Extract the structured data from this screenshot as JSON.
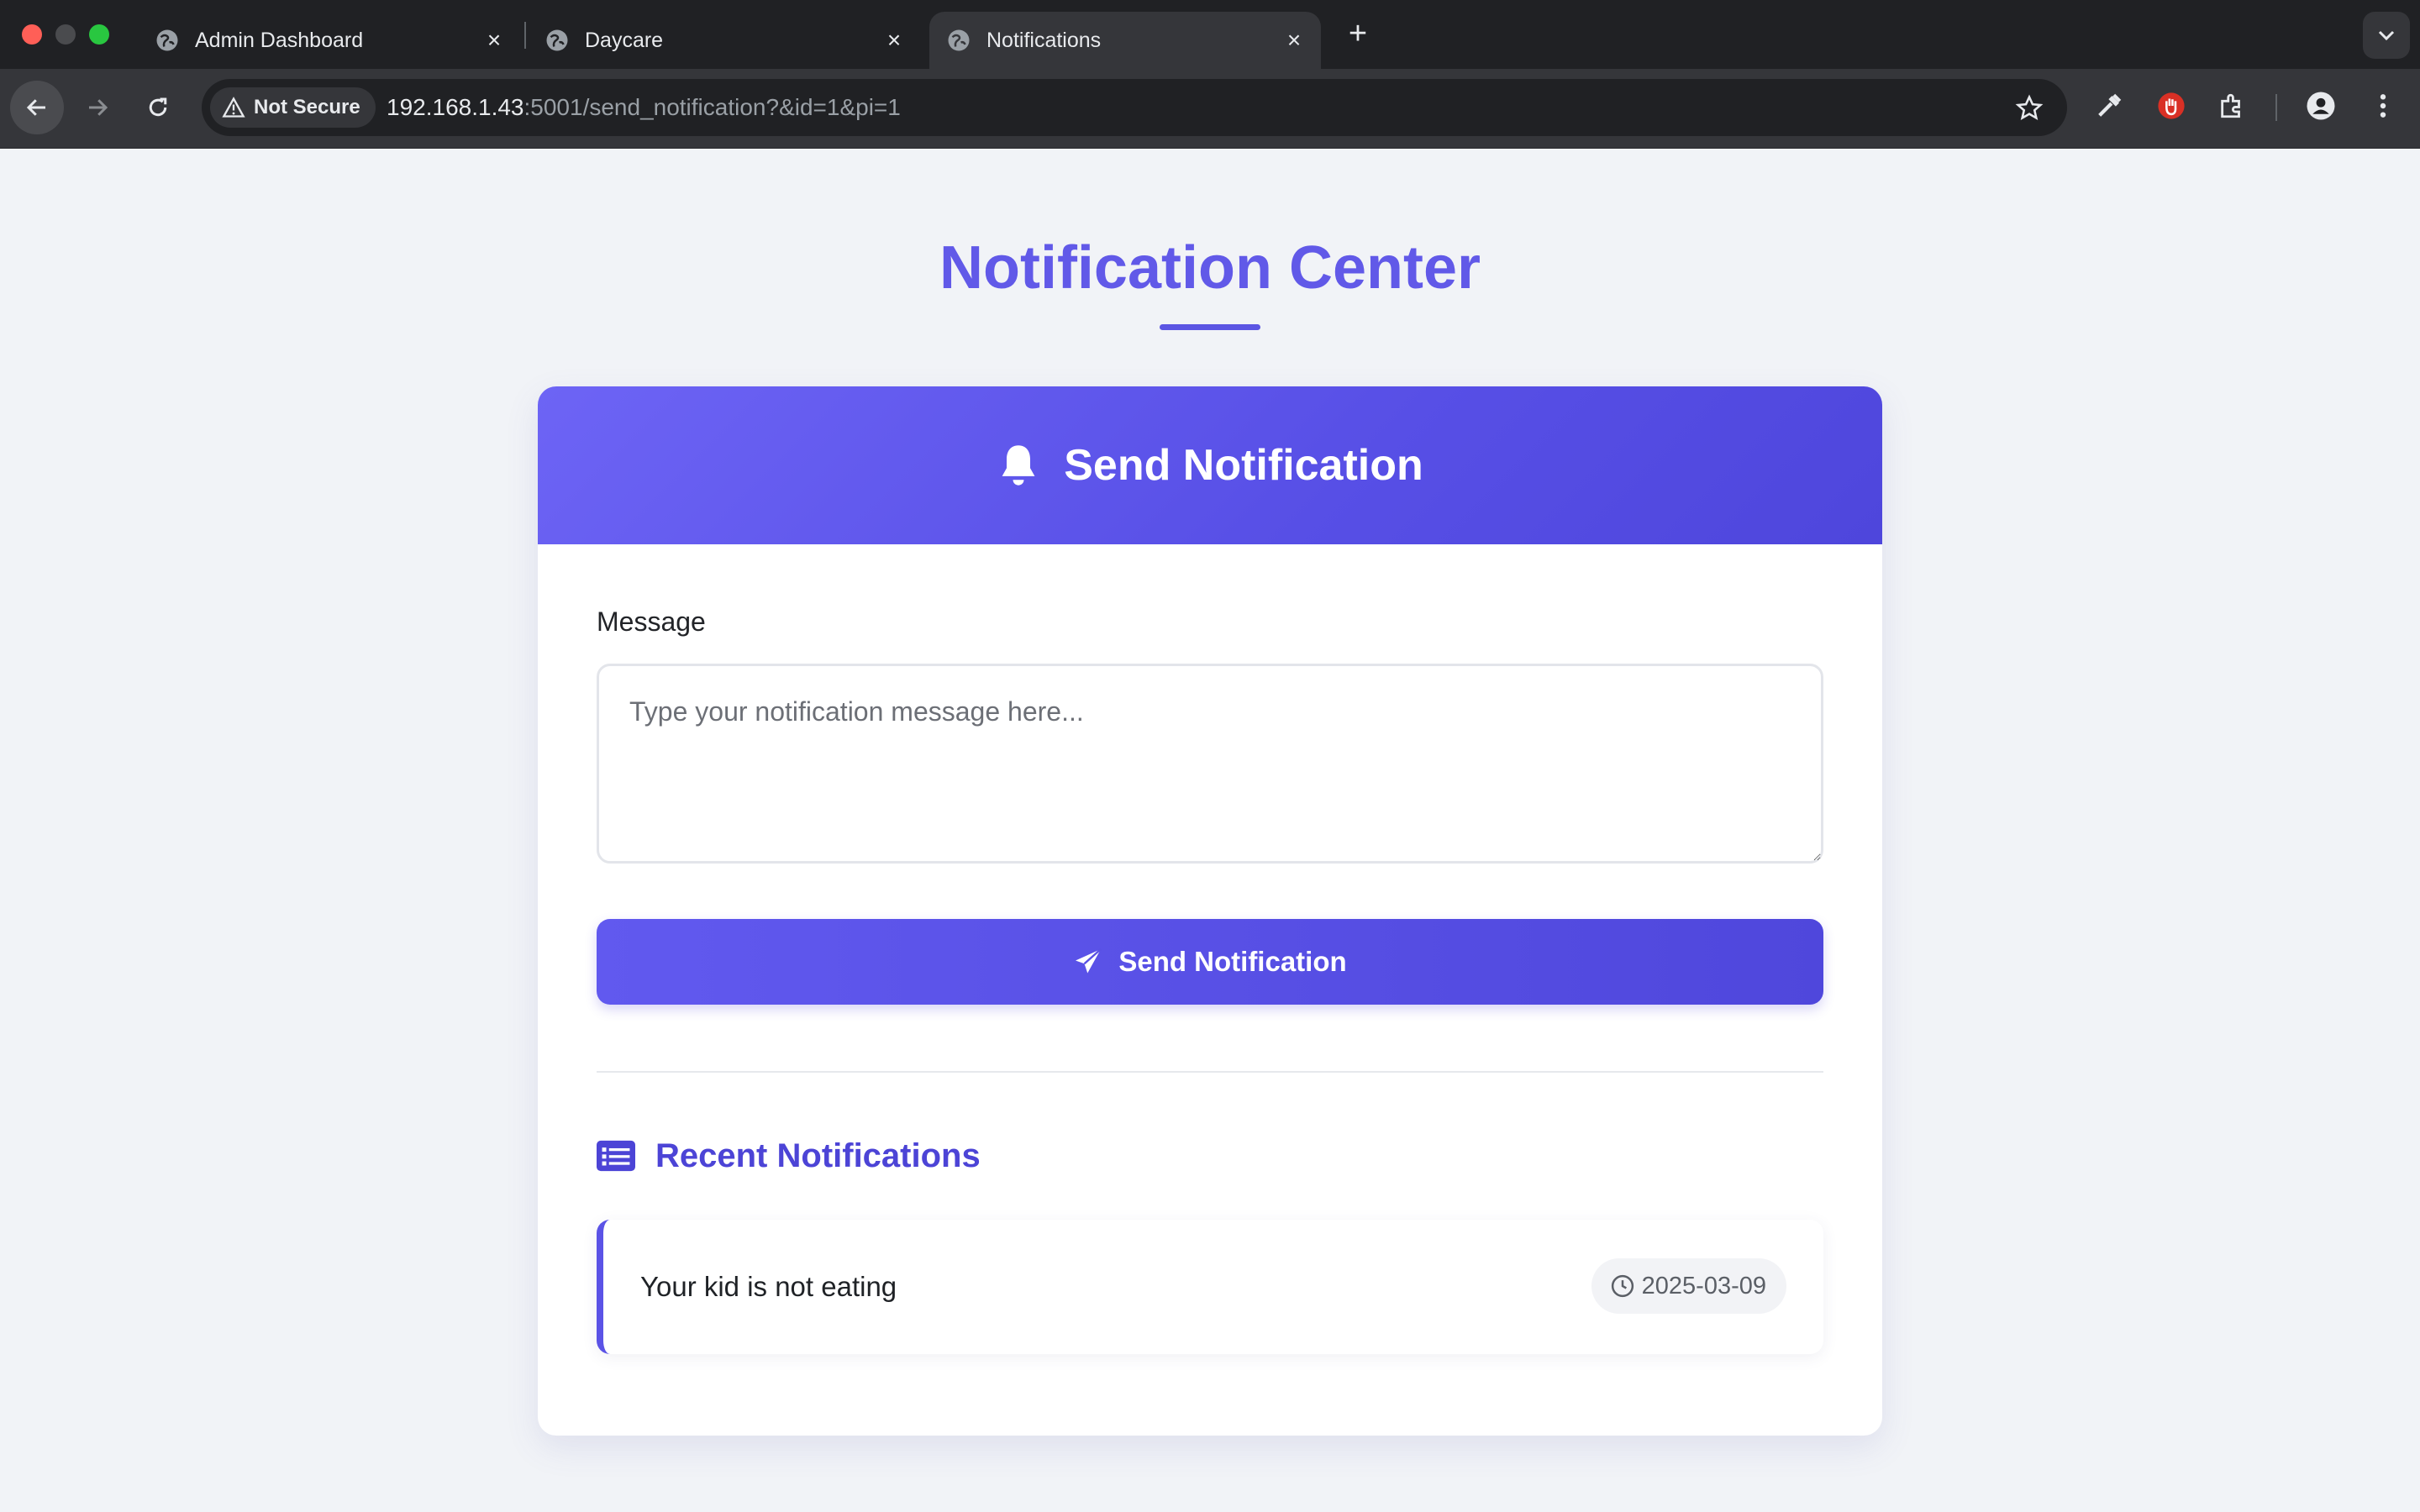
{
  "browser": {
    "tabs": [
      {
        "title": "Admin Dashboard",
        "active": false
      },
      {
        "title": "Daycare",
        "active": false
      },
      {
        "title": "Notifications",
        "active": true
      }
    ],
    "security_label": "Not Secure",
    "url_host": "192.168.1.43",
    "url_path": ":5001/send_notification?&id=1&pi=1"
  },
  "page": {
    "title": "Notification Center",
    "card_title": "Send Notification",
    "message_label": "Message",
    "message_placeholder": "Type your notification message here...",
    "message_value": "",
    "send_button_label": "Send Notification",
    "recent_title": "Recent Notifications",
    "notifications": [
      {
        "text": "Your kid is not eating",
        "date": "2025-03-09"
      }
    ]
  },
  "colors": {
    "accent": "#5b55e3",
    "header_gradient_start": "#6d64f5",
    "header_gradient_end": "#4e46dc",
    "page_background": "#f1f3f7"
  }
}
